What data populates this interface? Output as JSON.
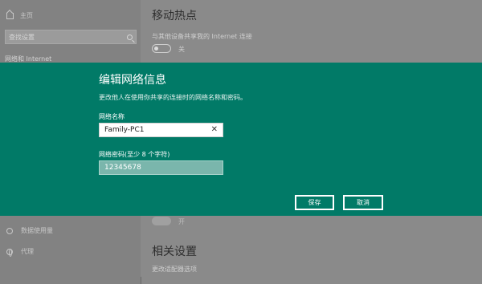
{
  "sidebar": {
    "home_label": "主页",
    "search_placeholder": "查找设置",
    "category": "网络和 Internet",
    "items": [
      {
        "label": "数据使用量",
        "icon": "data-usage-icon"
      },
      {
        "label": "代理",
        "icon": "globe-icon"
      }
    ]
  },
  "main": {
    "title": "移动热点",
    "subtitle": "与其他设备共享我的 Internet 连接",
    "toggle_state": "关",
    "toggle2_state": "开",
    "related_title": "相关设置",
    "related_link": "更改适配器选项"
  },
  "dialog": {
    "title": "编辑网络信息",
    "subtitle": "更改他人在使用你共享的连接时的网络名称和密码。",
    "name_label": "网络名称",
    "name_value": "Family-PC1",
    "password_label": "网络密码(至少 8 个字符)",
    "password_value": "12345678",
    "save_label": "保存",
    "cancel_label": "取消",
    "accent_color": "#017a67"
  }
}
